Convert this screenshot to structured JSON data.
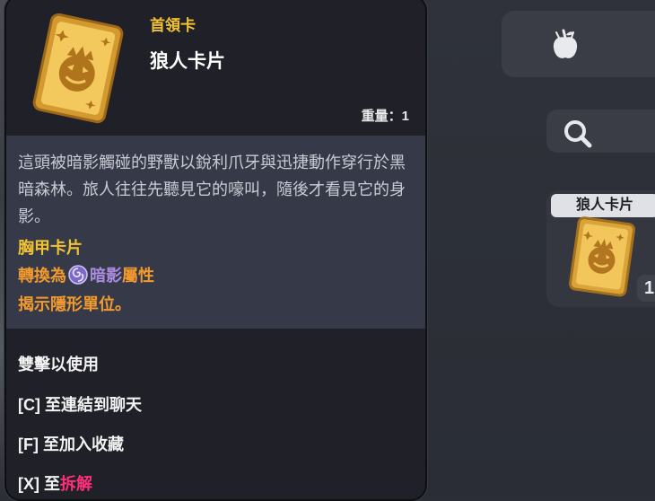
{
  "tooltip": {
    "card_type": "首領卡",
    "card_name": "狼人卡片",
    "weight_label": "重量：",
    "weight_value": "1",
    "description": "這頭被暗影觸碰的野獸以銳利爪牙與迅捷動作穿行於黑暗森林。旅人往往先聽見它的嚎叫，隨後才看見它的身影。",
    "slot_line": "胸甲卡片",
    "convert_prefix": "轉換為",
    "convert_element": "暗影",
    "convert_suffix": "屬性",
    "reveal_line": "揭示隱形單位。",
    "actions": {
      "double_click": "雙擊以使用",
      "link_chat": "[C] 至連結到聊天",
      "favorite": "[F] 至加入收藏",
      "dismantle_prefix": "[X] 至",
      "dismantle_action": "拆解"
    }
  },
  "inventory": {
    "slot_label": "狼人卡片",
    "slot_count": "1"
  },
  "colors": {
    "gold": "#f1c232",
    "orange": "#f29a2e",
    "shadow": "#a98ce0",
    "pink": "#ff2f7a"
  },
  "icons": [
    "card-icon",
    "apple-icon",
    "search-icon",
    "shadow-element-icon"
  ]
}
